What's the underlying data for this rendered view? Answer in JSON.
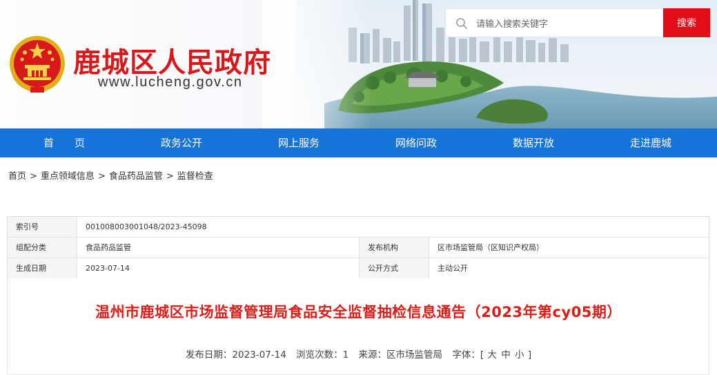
{
  "header": {
    "site_title": "鹿城区人民政府",
    "site_url": "www.lucheng.gov.cn"
  },
  "search": {
    "placeholder": "请输入搜索关键字",
    "button_label": "搜索"
  },
  "nav": {
    "items": [
      "首　　页",
      "政务公开",
      "网上服务",
      "网络问政",
      "数据开放",
      "走进鹿城"
    ]
  },
  "breadcrumb": {
    "items": [
      "首页",
      "重点领域信息",
      "食品药品监管",
      "监督检查"
    ],
    "separator": ">"
  },
  "meta": {
    "index_label": "索引号",
    "index_value": "001008003001048/2023-45098",
    "category_label": "组配分类",
    "category_value": "食品药品监管",
    "publisher_label": "发布机构",
    "publisher_value": "区市场监管局（区知识产权局）",
    "date_label": "生成日期",
    "date_value": "2023-07-14",
    "disclosure_label": "公开方式",
    "disclosure_value": "主动公开"
  },
  "article": {
    "title": "温州市鹿城区市场监督管理局食品安全监督抽检信息通告（2023年第cy05期）",
    "publish_date": "发布日期：2023-07-14",
    "views": "浏览次数：1",
    "source": "来源：区市场监管局",
    "font_label": "字体：[",
    "font_large": "大",
    "font_medium": "中",
    "font_small": "小",
    "font_close": "]"
  },
  "colors": {
    "brand_red": "#d7191b",
    "nav_blue": "#1674d8",
    "search_red": "#e20e17"
  }
}
